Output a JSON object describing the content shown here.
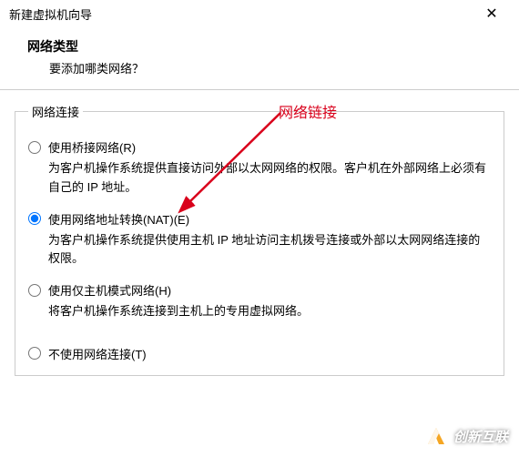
{
  "window": {
    "title": "新建虚拟机向导",
    "close": "✕"
  },
  "header": {
    "title": "网络类型",
    "subtitle": "要添加哪类网络？"
  },
  "fieldset": {
    "legend": "网络连接"
  },
  "options": {
    "bridge": {
      "label": "使用桥接网络(R)",
      "desc": "为客户机操作系统提供直接访问外部以太网网络的权限。客户机在外部网络上必须有自己的 IP 地址。"
    },
    "nat": {
      "label": "使用网络地址转换(NAT)(E)",
      "desc": "为客户机操作系统提供使用主机 IP 地址访问主机拨号连接或外部以太网网络连接的权限。"
    },
    "hostonly": {
      "label": "使用仅主机模式网络(H)",
      "desc": "将客户机操作系统连接到主机上的专用虚拟网络。"
    },
    "none": {
      "label": "不使用网络连接(T)"
    }
  },
  "annotation": {
    "text": "网络链接"
  },
  "watermark": {
    "text": "创新互联"
  }
}
